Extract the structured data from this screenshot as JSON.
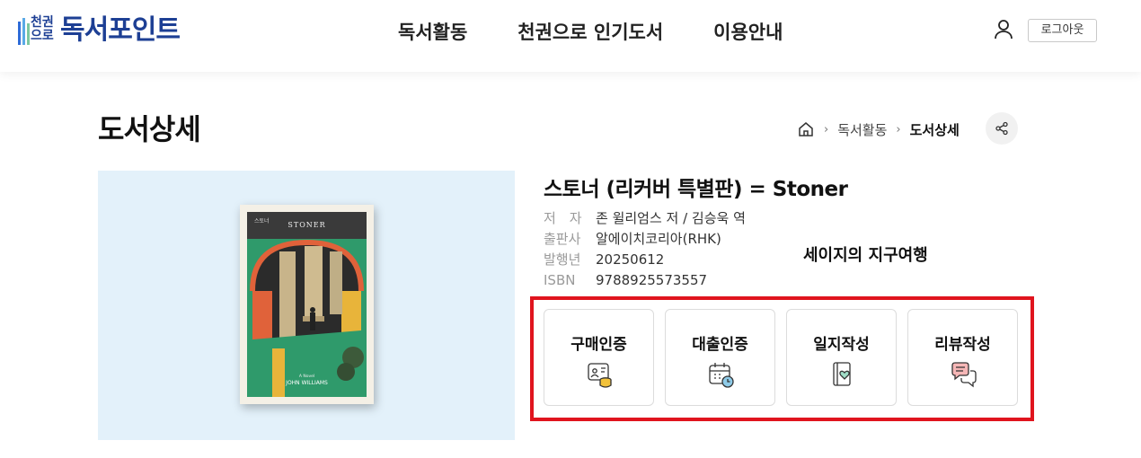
{
  "header": {
    "logo_mark_line1": "천권",
    "logo_mark_line2": "으로",
    "logo_text": "독서포인트",
    "nav": [
      "독서활동",
      "천권으로 인기도서",
      "이용안내"
    ],
    "logout_label": "로그아웃"
  },
  "page": {
    "title": "도서상세",
    "breadcrumb": {
      "parent": "독서활동",
      "current": "도서상세"
    }
  },
  "cover": {
    "title_kr": "스토너",
    "title_en": "STONER",
    "subtitle": "A Novel",
    "author": "JOHN WILLIAMS",
    "colors": {
      "frame": "#f4f0e6",
      "header": "#3a3a3a",
      "green": "#2f9a6b",
      "orange": "#e0623a",
      "yellow": "#e8b43a"
    }
  },
  "book": {
    "title": "스토너 (리커버 특별판) = Stoner",
    "meta": [
      {
        "label": "저　자",
        "value": "존 윌리엄스 저 / 김승욱 역"
      },
      {
        "label": "출판사",
        "value": "알에이치코리아(RHK)"
      },
      {
        "label": "발행년",
        "value": "20250612"
      },
      {
        "label": "ISBN",
        "value": "9788925573557"
      }
    ],
    "reading_note": "세이지의 지구여행"
  },
  "actions": [
    {
      "label": "구매인증",
      "icon": "purchase-verify-icon"
    },
    {
      "label": "대출인증",
      "icon": "loan-calendar-icon"
    },
    {
      "label": "일지작성",
      "icon": "journal-heart-icon"
    },
    {
      "label": "리뷰작성",
      "icon": "review-chat-icon"
    }
  ],
  "colors": {
    "brand": "#1d3f94",
    "highlight": "#e0141e",
    "cover_bg": "#e3f1fa"
  }
}
